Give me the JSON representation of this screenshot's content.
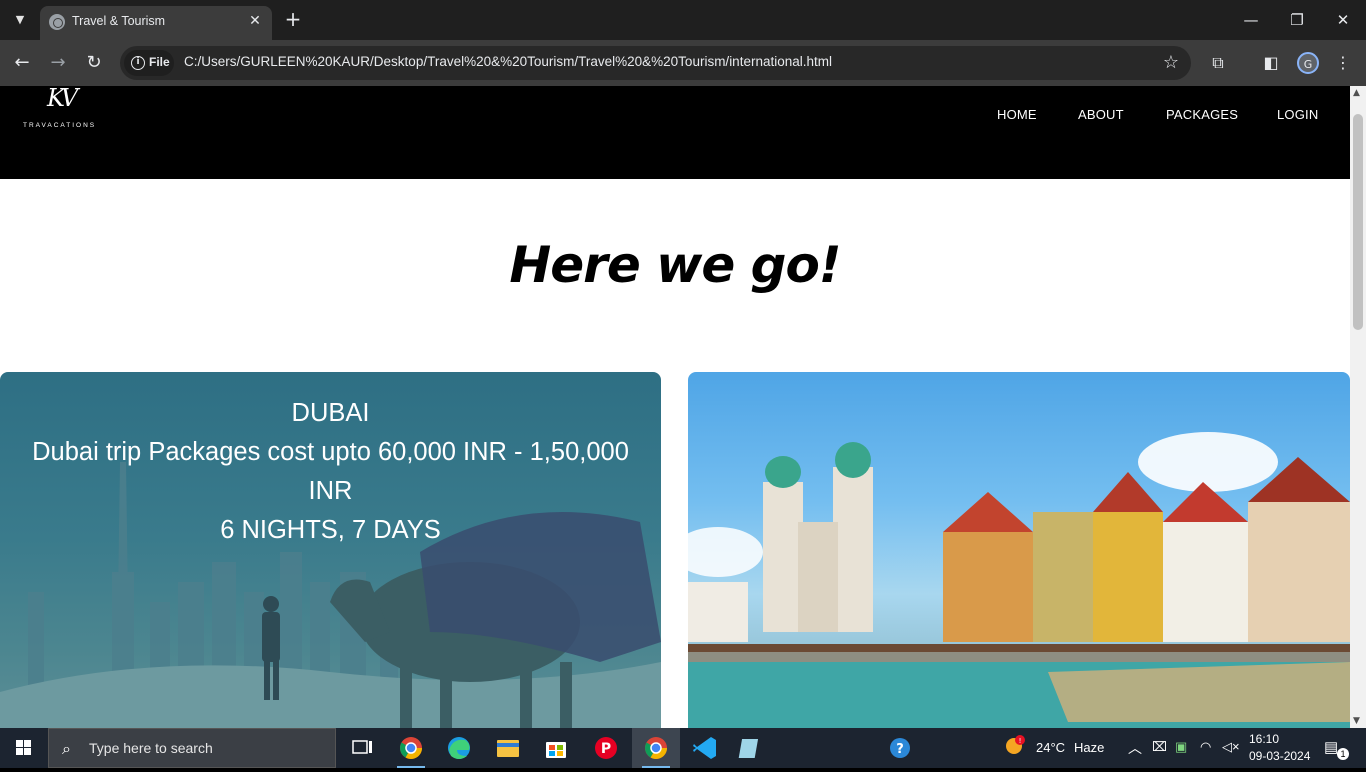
{
  "browser": {
    "tab_title": "Travel & Tourism",
    "tab_close": "✕",
    "new_tab": "+",
    "url_chip": "File",
    "url": "C:/Users/GURLEEN%20KAUR/Desktop/Travel%20&%20Tourism/Travel%20&%20Tourism/international.html",
    "profile_initial": "G"
  },
  "site": {
    "logo_mark": "KV",
    "logo_text": "TRAVACATIONS",
    "nav": [
      "HOME",
      "ABOUT",
      "PACKAGES",
      "LOGIN"
    ],
    "hero_title": "Here we go!",
    "cards": [
      {
        "title": "DUBAI",
        "line1": "Dubai trip Packages cost upto 60,000 INR - 1,50,000",
        "line2": "INR",
        "line3": "6 NIGHTS, 7 DAYS"
      }
    ]
  },
  "taskbar": {
    "search_placeholder": "Type here to search",
    "weather_temp": "24°C",
    "weather_desc": "Haze",
    "time": "16:10",
    "date": "09-03-2024",
    "notification_count": "1"
  }
}
